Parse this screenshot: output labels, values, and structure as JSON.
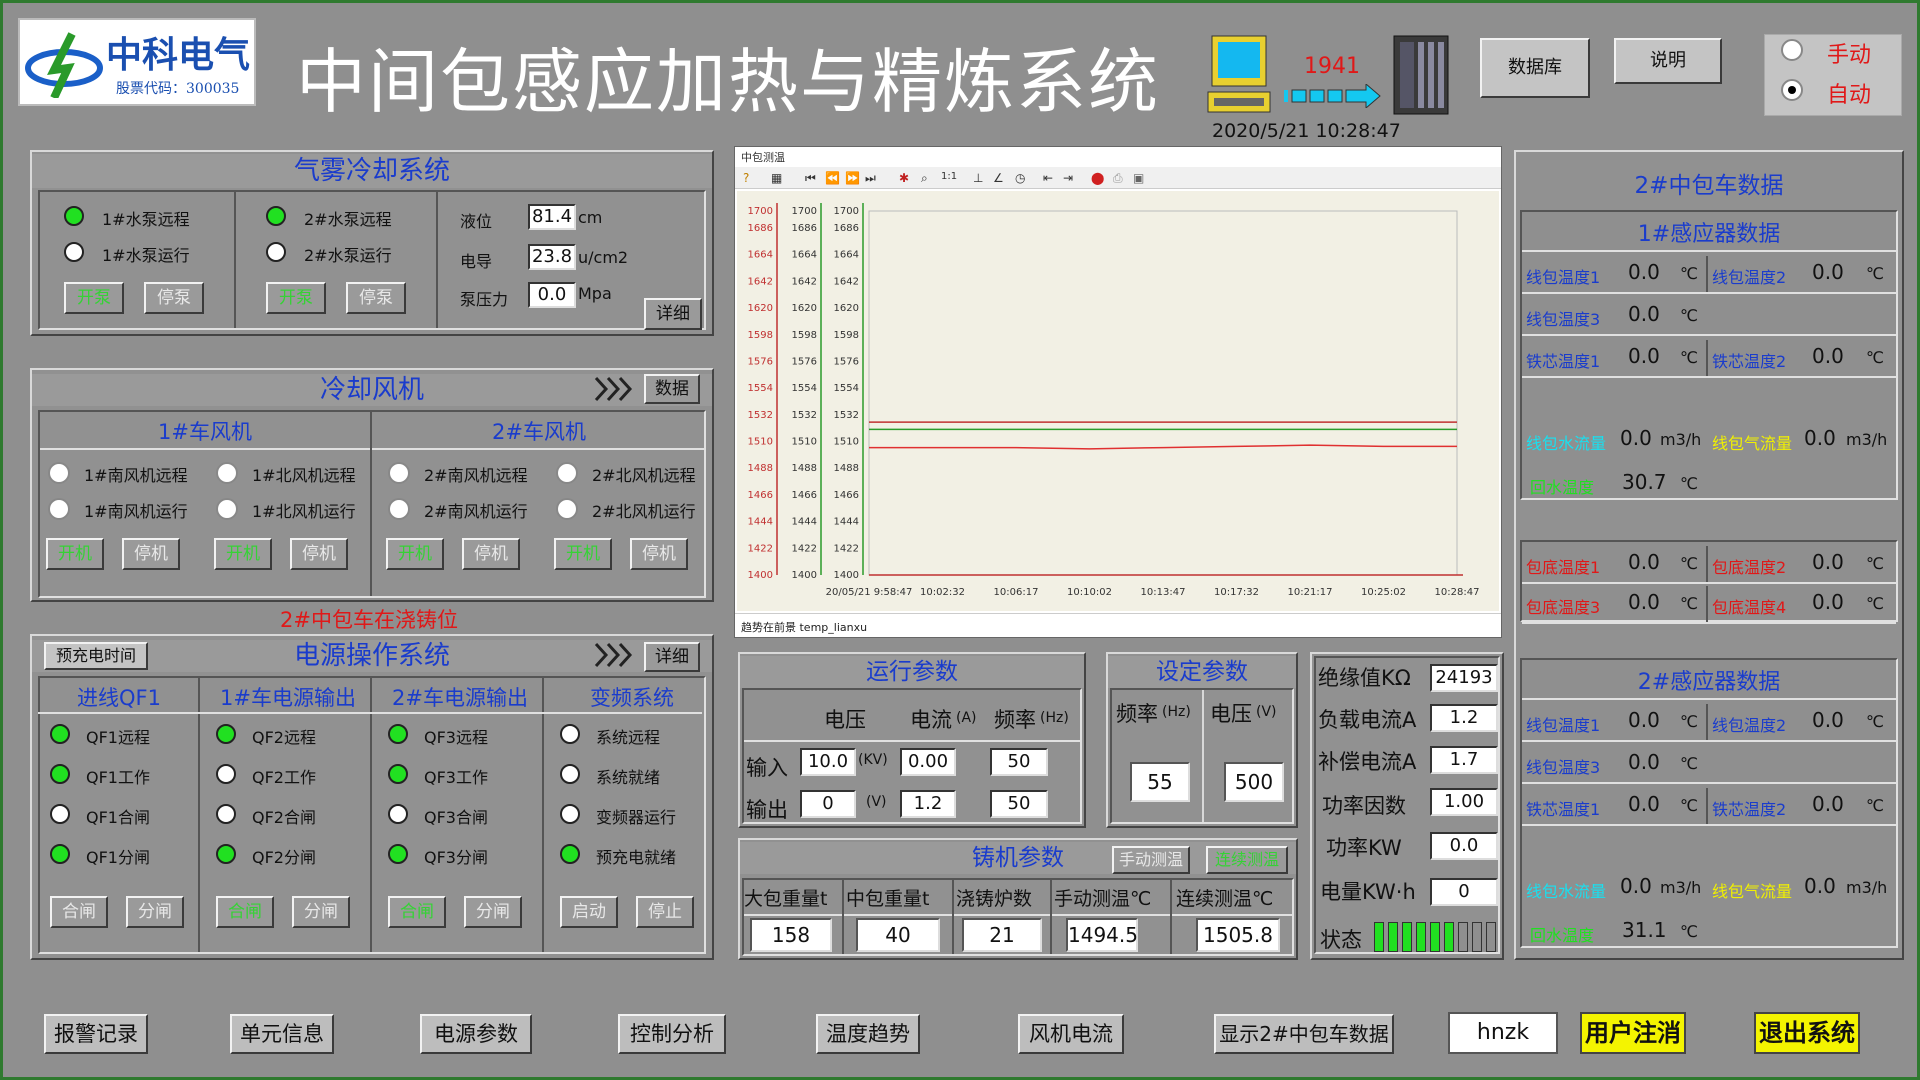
{
  "header": {
    "logo_name": "中科电气",
    "logo_stock": "股票代码：300035",
    "title": "中间包感应加热与精炼系统",
    "counter": "1941",
    "datetime": "2020/5/21 10:28:47",
    "btn_db": "数据库",
    "btn_help": "说明",
    "mode_manual": "手动",
    "mode_auto": "自动",
    "mode_selected": "自动"
  },
  "mist": {
    "title": "气雾冷却系统",
    "pump1_remote": "1#水泵远程",
    "pump1_run": "1#水泵运行",
    "pump2_remote": "2#水泵远程",
    "pump2_run": "2#水泵运行",
    "start": "开泵",
    "stop": "停泵",
    "level_label": "液位",
    "level_value": "81.4",
    "level_unit": "cm",
    "cond_label": "电导",
    "cond_value": "23.8",
    "cond_unit": "u/cm2",
    "press_label": "泵压力",
    "press_value": "0.0",
    "press_unit": "Mpa",
    "detail": "详细"
  },
  "fan": {
    "title": "冷却风机",
    "data_btn": "数据",
    "car1": "1#车风机",
    "car2": "2#车风机",
    "items": [
      {
        "remote": "1#南风机远程",
        "run": "1#南风机运行"
      },
      {
        "remote": "1#北风机远程",
        "run": "1#北风机运行"
      },
      {
        "remote": "2#南风机远程",
        "run": "2#南风机运行"
      },
      {
        "remote": "2#北风机远程",
        "run": "2#北风机运行"
      }
    ],
    "start": "开机",
    "stop": "停机"
  },
  "status_msg": "2#中包车在浇铸位",
  "power": {
    "title": "电源操作系统",
    "precharge_btn": "预充电时间",
    "detail": "详细",
    "cols": [
      {
        "title": "进线QF1",
        "items": [
          "QF1远程",
          "QF1工作",
          "QF1合闸",
          "QF1分闸"
        ],
        "on": [
          true,
          true,
          false,
          true
        ],
        "b1": "合闸",
        "b2": "分闸"
      },
      {
        "title": "1#车电源输出",
        "items": [
          "QF2远程",
          "QF2工作",
          "QF2合闸",
          "QF2分闸"
        ],
        "on": [
          true,
          false,
          false,
          true
        ],
        "b1": "合闸",
        "b2": "分闸"
      },
      {
        "title": "2#车电源输出",
        "items": [
          "QF3远程",
          "QF3工作",
          "QF3合闸",
          "QF3分闸"
        ],
        "on": [
          true,
          true,
          false,
          true
        ],
        "b1": "合闸",
        "b2": "分闸"
      },
      {
        "title": "变频系统",
        "items": [
          "系统远程",
          "系统就绪",
          "变频器运行",
          "预充电就绪"
        ],
        "on": [
          false,
          false,
          false,
          true
        ],
        "b1": "启动",
        "b2": "停止"
      }
    ]
  },
  "chart_window": {
    "title": "中包测温",
    "status": "趋势在前景 temp_lianxu"
  },
  "chart_data": {
    "type": "line",
    "x": [
      "20/05/21 9:58:47",
      "10:02:32",
      "10:06:17",
      "10:10:02",
      "10:13:47",
      "10:17:32",
      "10:21:17",
      "10:25:02",
      "10:28:47"
    ],
    "ylim": [
      1400,
      1700
    ],
    "yticks": [
      1700,
      1686,
      1664,
      1642,
      1620,
      1598,
      1576,
      1554,
      1532,
      1510,
      1488,
      1466,
      1444,
      1422,
      1400
    ],
    "series": [
      {
        "color": "#c03030",
        "values": [
          1526,
          1526,
          1526,
          1526,
          1526,
          1526,
          1526,
          1526,
          1526
        ]
      },
      {
        "color": "#2a9a2a",
        "values": [
          1520,
          1520,
          1520,
          1520,
          1520,
          1520,
          1520,
          1520,
          1520
        ]
      },
      {
        "color": "#e03030",
        "values": [
          1505,
          1505,
          1505,
          1504,
          1505,
          1506,
          1507,
          1506,
          1506
        ]
      }
    ]
  },
  "run_params": {
    "title": "运行参数",
    "col_voltage": "电压",
    "col_current": "电流",
    "col_current_unit": "(A)",
    "col_freq": "频率",
    "col_freq_unit": "(Hz)",
    "row_in": "输入",
    "row_out": "输出",
    "in_voltage": "10.0",
    "in_voltage_unit": "(KV)",
    "in_current": "0.00",
    "in_freq": "50",
    "out_voltage": "0",
    "out_voltage_unit": "(V)",
    "out_current": "1.2",
    "out_freq": "50"
  },
  "set_params": {
    "title": "设定参数",
    "col_freq": "频率",
    "col_freq_unit": "(Hz)",
    "col_voltage": "电压",
    "col_voltage_unit": "(V)",
    "freq": "55",
    "voltage": "500"
  },
  "insulation": {
    "label": "绝缘值KΩ",
    "value": "24193",
    "load_label": "负载电流A",
    "load_value": "1.2",
    "comp_label": "补偿电流A",
    "comp_value": "1.7",
    "pf_label": "功率因数",
    "pf_value": "1.00",
    "kw_label": "功率KW",
    "kw_value": "0.0",
    "kwh_label": "电量KW·h",
    "kwh_value": "0",
    "state_label": "状态",
    "state_level": 0.7
  },
  "caster": {
    "title": "铸机参数",
    "manual_btn": "手动测温",
    "cont_btn": "连续测温",
    "h_big": "大包重量t",
    "h_mid": "中包重量t",
    "h_heats": "浇铸炉数",
    "h_manual": "手动测温℃",
    "h_cont": "连续测温℃",
    "big": "158",
    "mid": "40",
    "heats": "21",
    "manual": "1494.5",
    "cont": "1505.8"
  },
  "car2": {
    "title": "2#中包车数据",
    "s1_title": "1#感应器数据",
    "s2_title": "2#感应器数据",
    "coil1": "线包温度1",
    "coil2": "线包温度2",
    "coil3": "线包温度3",
    "core1": "铁芯温度1",
    "core2": "铁芯温度2",
    "water": "线包水流量",
    "gas": "线包气流量",
    "ret": "回水温度",
    "deg": "℃",
    "flow_unit": "m3/h",
    "b1": "包底温度1",
    "b2": "包底温度2",
    "b3": "包底温度3",
    "b4": "包底温度4",
    "s1": {
      "c1": "0.0",
      "c2": "0.0",
      "c3": "0.0",
      "k1": "0.0",
      "k2": "0.0",
      "w": "0.0",
      "g": "0.0",
      "r": "30.7"
    },
    "bottom": {
      "b1": "0.0",
      "b2": "0.0",
      "b3": "0.0",
      "b4": "0.0"
    },
    "s2": {
      "c1": "0.0",
      "c2": "0.0",
      "c3": "0.0",
      "k1": "0.0",
      "k2": "0.0",
      "w": "0.0",
      "g": "0.0",
      "r": "31.1"
    }
  },
  "footer": {
    "alarm": "报警记录",
    "unit": "单元信息",
    "power": "电源参数",
    "control": "控制分析",
    "trend": "温度趋势",
    "fan": "风机电流",
    "show2": "显示2#中包车数据",
    "user": "hnzk",
    "logout": "用户注消",
    "exit": "退出系统"
  }
}
